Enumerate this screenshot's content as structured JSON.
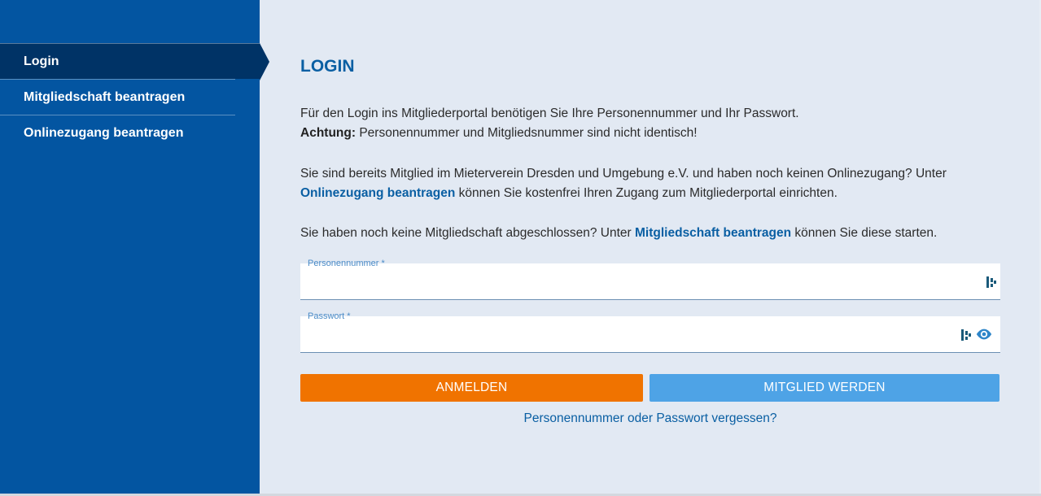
{
  "sidebar": {
    "items": [
      {
        "label": "Login",
        "active": true
      },
      {
        "label": "Mitgliedschaft beantragen",
        "active": false
      },
      {
        "label": "Onlinezugang beantragen",
        "active": false
      }
    ]
  },
  "main": {
    "title": "LOGIN",
    "p1_line1": "Für den Login ins Mitgliederportal benötigen Sie Ihre Personennummer und Ihr Passwort.",
    "p1_bold": "Achtung:",
    "p1_line2": " Personennummer und Mitgliedsnummer sind nicht identisch!",
    "p2_text1": "Sie sind bereits Mitglied im Mieterverein Dresden und Umgebung e.V. und haben noch keinen Onlinezugang? Unter ",
    "p2_link": "Onlinezugang beantragen",
    "p2_text2": " können Sie kostenfrei Ihren Zugang zum Mitgliederportal einrichten.",
    "p3_text1": "Sie haben noch keine Mitgliedschaft abgeschlossen? Unter ",
    "p3_link": "Mitgliedschaft beantragen",
    "p3_text2": " können Sie diese starten."
  },
  "form": {
    "personennummer_label": "Personennummer *",
    "personennummer_value": "",
    "passwort_label": "Passwort *",
    "passwort_value": "",
    "login_button": "ANMELDEN",
    "member_button": "MITGLIED WERDEN",
    "forgot_link": "Personennummer oder Passwort vergessen?"
  },
  "colors": {
    "sidebar": "#0355a1",
    "sidebar_active": "#003366",
    "accent_orange": "#f07300",
    "accent_blue": "#4ea3e6",
    "link": "#0a5fa3"
  },
  "icons": [
    "password-manager-icon",
    "eye-icon"
  ]
}
